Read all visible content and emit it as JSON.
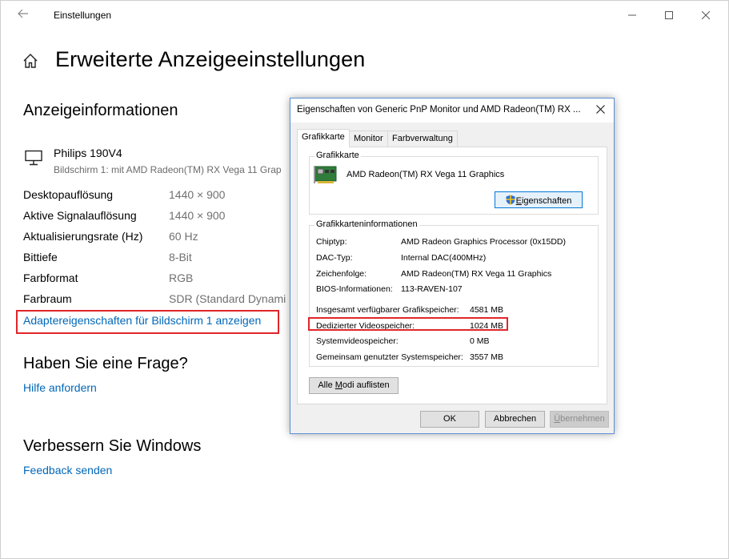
{
  "window": {
    "app_title": "Einstellungen",
    "page_title": "Erweiterte Anzeigeeinstellungen"
  },
  "display_info": {
    "section_title": "Anzeigeinformationen",
    "monitor_name": "Philips 190V4",
    "monitor_subtitle": "Bildschirm 1: mit AMD Radeon(TM) RX Vega 11 Grap",
    "rows": [
      {
        "label": "Desktopauflösung",
        "value": "1440 × 900"
      },
      {
        "label": "Aktive Signalauflösung",
        "value": "1440 × 900"
      },
      {
        "label": "Aktualisierungsrate (Hz)",
        "value": "60 Hz"
      },
      {
        "label": "Bittiefe",
        "value": "8-Bit"
      },
      {
        "label": "Farbformat",
        "value": "RGB"
      },
      {
        "label": "Farbraum",
        "value": "SDR (Standard Dynami"
      }
    ],
    "adapter_link": "Adaptereigenschaften für Bildschirm 1 anzeigen"
  },
  "help": {
    "title": "Haben Sie eine Frage?",
    "link": "Hilfe anfordern"
  },
  "improve": {
    "title": "Verbessern Sie Windows",
    "link": "Feedback senden"
  },
  "dialog": {
    "title": "Eigenschaften von Generic PnP Monitor und AMD Radeon(TM) RX ...",
    "tabs": [
      "Grafikkarte",
      "Monitor",
      "Farbverwaltung"
    ],
    "active_tab": "Grafikkarte",
    "adapter_group": {
      "legend": "Grafikkarte",
      "name": "AMD Radeon(TM) RX Vega 11 Graphics",
      "properties_button_accel": "E",
      "properties_button_rest": "igenschaften"
    },
    "info_group": {
      "legend": "Grafikkarteninformationen",
      "rows": [
        {
          "label": "Chiptyp:",
          "value": "AMD Radeon Graphics Processor (0x15DD)"
        },
        {
          "label": "DAC-Typ:",
          "value": "Internal DAC(400MHz)"
        },
        {
          "label": "Zeichenfolge:",
          "value": "AMD Radeon(TM) RX Vega 11 Graphics"
        },
        {
          "label": "BIOS-Informationen:",
          "value": "113-RAVEN-107"
        }
      ],
      "memory": [
        {
          "label": "Insgesamt verfügbarer Grafikspeicher:",
          "value": "4581 MB"
        },
        {
          "label": "Dedizierter Videospeicher:",
          "value": "1024 MB"
        },
        {
          "label": "Systemvideospeicher:",
          "value": "0 MB"
        },
        {
          "label": "Gemeinsam genutzter Systemspeicher:",
          "value": "3557 MB"
        }
      ]
    },
    "list_modes_pre": "Alle ",
    "list_modes_accel": "M",
    "list_modes_post": "odi auflisten",
    "ok": "OK",
    "cancel": "Abbrechen",
    "apply_accel": "Ü",
    "apply_rest": "bernehmen"
  },
  "colors": {
    "link": "#0067b8",
    "highlight": "#e0262a",
    "dialog_border": "#5b8fd6"
  }
}
